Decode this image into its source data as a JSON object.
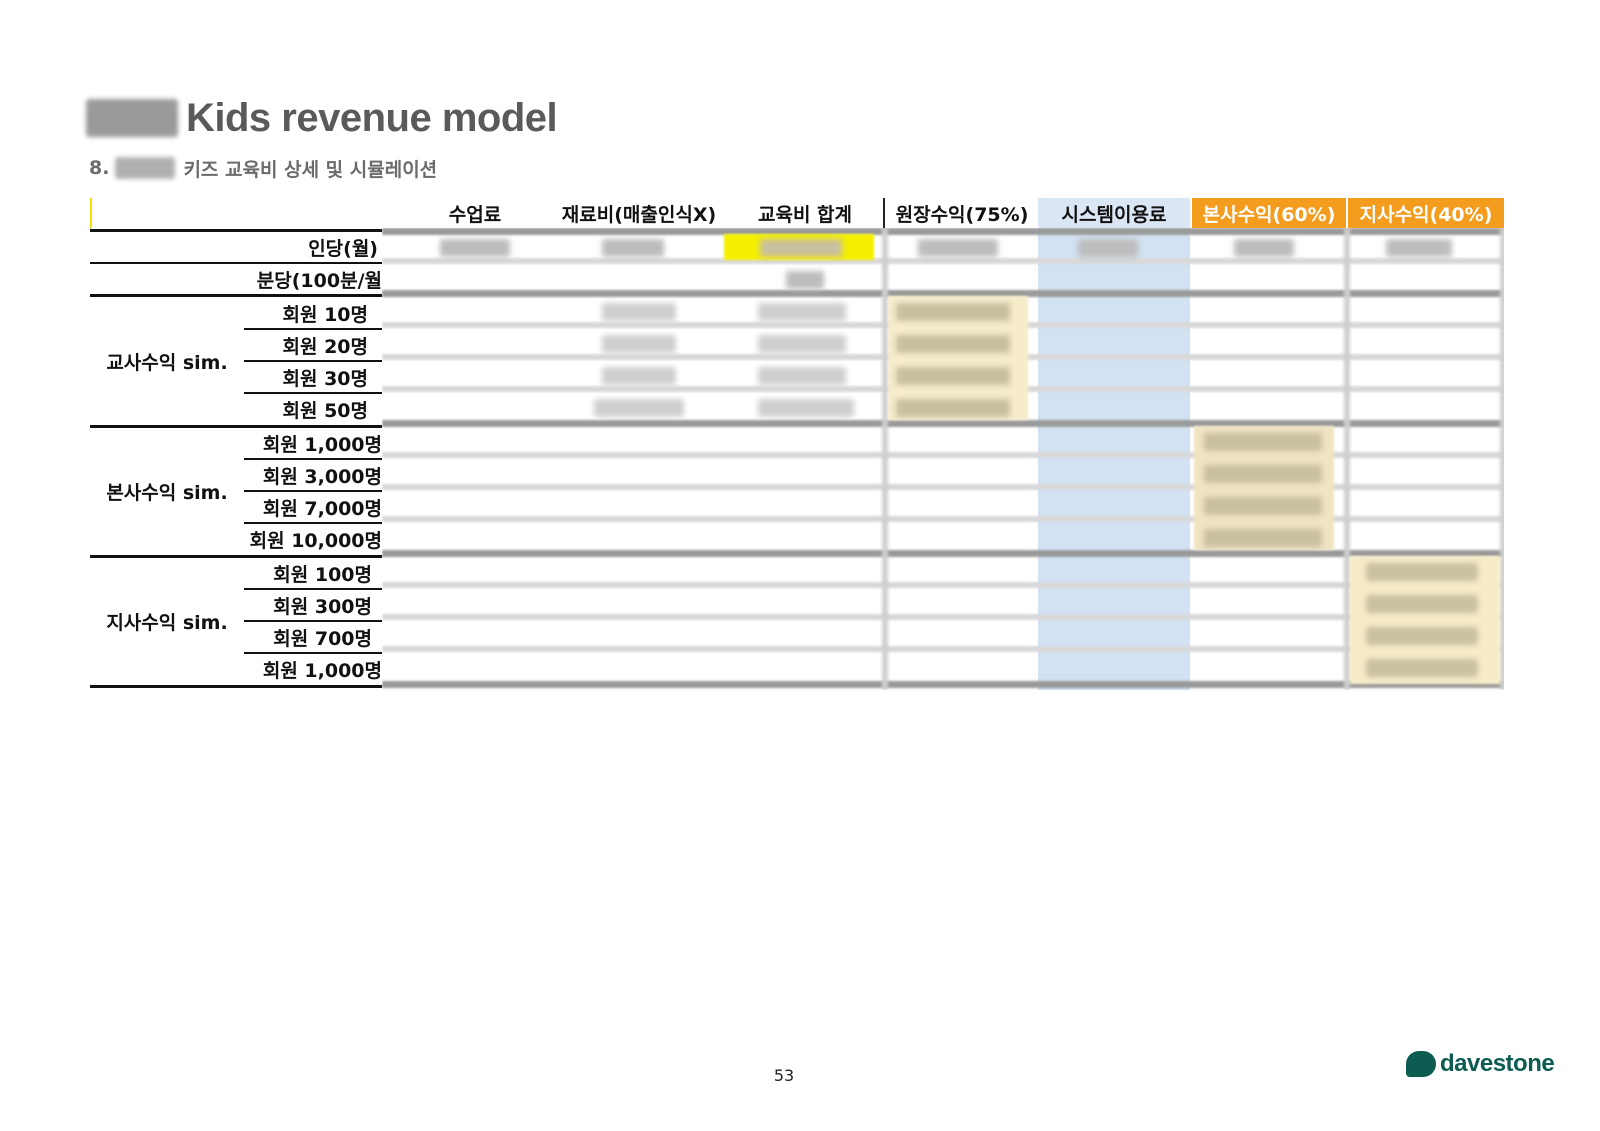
{
  "header": {
    "title": "Kids revenue model",
    "subtitle_number": "8.",
    "subtitle_text": "키즈 교육비 상세 및 시뮬레이션"
  },
  "table": {
    "columns": [
      "수업료",
      "재료비(매출인식X)",
      "교육비 합계",
      "원장수익(75%)",
      "시스템이용료",
      "본사수익(60%)",
      "지사수익(40%)"
    ],
    "top_rows": [
      "인당(월)",
      "분당(100분/월"
    ],
    "groups": [
      {
        "label": "교사수익 sim.",
        "rows": [
          "회원 10명",
          "회원 20명",
          "회원 30명",
          "회원 50명"
        ]
      },
      {
        "label": "본사수익 sim.",
        "rows": [
          "회원 1,000명",
          "회원 3,000명",
          "회원 7,000명",
          "회원 10,000명"
        ]
      },
      {
        "label": "지사수익 sim.",
        "rows": [
          "회원 100명",
          "회원 300명",
          "회원 700명",
          "회원 1,000명"
        ]
      }
    ]
  },
  "colors": {
    "accent_orange": "#f39c1d",
    "system_fee_blue": "#dbe6f4",
    "highlight_yellow": "#f5f000",
    "brand_green": "#0d5c52"
  },
  "footer": {
    "page_number": "53",
    "logo_text": "davestone"
  }
}
